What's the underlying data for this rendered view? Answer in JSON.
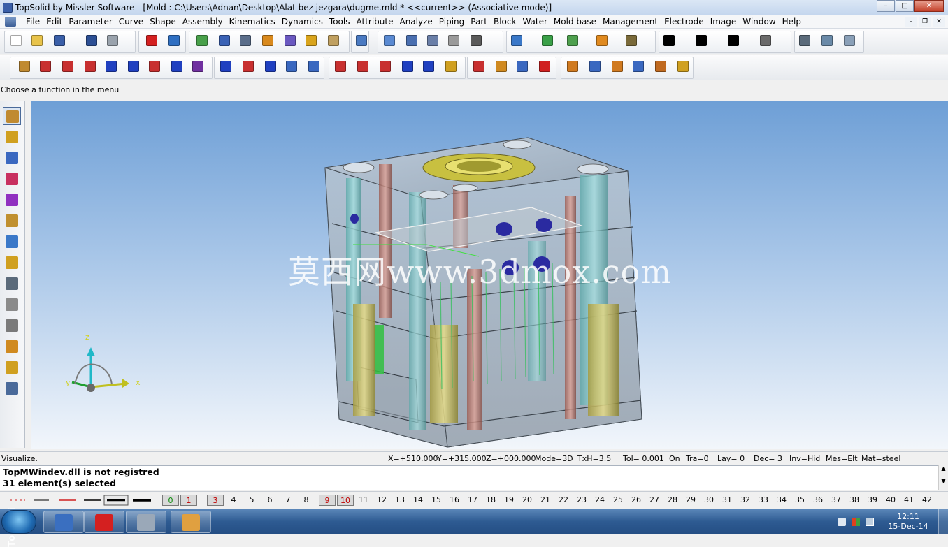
{
  "window": {
    "title": "TopSolid by Missler Software - [Mold : C:\\Users\\Adnan\\Desktop\\Alat bez jezgara\\dugme.mld *  <<current>> (Associative mode)]",
    "minimize": "–",
    "maximize": "□",
    "close": "✕"
  },
  "menu": [
    "File",
    "Edit",
    "Parameter",
    "Curve",
    "Shape",
    "Assembly",
    "Kinematics",
    "Dynamics",
    "Tools",
    "Attribute",
    "Analyze",
    "Piping",
    "Part",
    "Block",
    "Water",
    "Mold base",
    "Management",
    "Electrode",
    "Image",
    "Window",
    "Help"
  ],
  "mdi_buttons": [
    "–",
    "❐",
    "✕"
  ],
  "toolbar1": [
    {
      "name": "new-file-icon",
      "color": "#ffffff"
    },
    {
      "name": "open-folder-icon",
      "color": "#e8c34a"
    },
    {
      "name": "save-icon",
      "color": "#3a5fa8"
    },
    {
      "name": "info-icon",
      "color": "#2c4f94"
    },
    {
      "name": "print-icon",
      "color": "#9aa3ad"
    },
    {
      "name": "delete-icon",
      "color": "#d42020"
    },
    {
      "name": "undo-icon",
      "color": "#2f6fc2"
    },
    {
      "name": "refresh-icon",
      "color": "#48a04a"
    },
    {
      "name": "render-icon",
      "color": "#3a62b5"
    },
    {
      "name": "mixer-icon",
      "color": "#5a6d8a"
    },
    {
      "name": "hammer-icon",
      "color": "#d9891c"
    },
    {
      "name": "tools-icon",
      "color": "#6a58c0"
    },
    {
      "name": "magic-icon",
      "color": "#d9a41c"
    },
    {
      "name": "eye-icon",
      "color": "#c0a060"
    },
    {
      "name": "select-icon",
      "color": "#4a7ac2"
    },
    {
      "name": "pick-icon",
      "color": "#5a8ad2"
    },
    {
      "name": "trim-icon",
      "color": "#4a6fb0"
    },
    {
      "name": "gauge-icon",
      "color": "#6a7fa8"
    },
    {
      "name": "magnet-icon",
      "color": "#9a9a9a"
    },
    {
      "name": "sketch-icon",
      "color": "#5a5a5a"
    },
    {
      "name": "zoom-icon",
      "color": "#3a78c8"
    },
    {
      "name": "zoom-fit-icon",
      "color": "#3aa048"
    },
    {
      "name": "view-icon",
      "color": "#4ea04e"
    },
    {
      "name": "rotate-icon",
      "color": "#e08a20"
    },
    {
      "name": "pan-icon",
      "color": "#7a6a3a"
    },
    {
      "name": "color-black-icon",
      "color": "#000000"
    },
    {
      "name": "point-style-icon",
      "color": "#000000"
    },
    {
      "name": "line-style-icon",
      "color": "#000000"
    },
    {
      "name": "hatch-icon",
      "color": "#6a6a6a"
    },
    {
      "name": "camera-icon",
      "color": "#5a6a7a"
    },
    {
      "name": "layers-icon",
      "color": "#6a8aa8"
    },
    {
      "name": "box-view-icon",
      "color": "#8aa0b8"
    }
  ],
  "toolbar2": [
    {
      "name": "pencil-icon",
      "color": "#c08a30"
    },
    {
      "name": "polyline-icon",
      "color": "#c83030"
    },
    {
      "name": "line-icon",
      "color": "#c83030"
    },
    {
      "name": "circle-icon",
      "color": "#c83030"
    },
    {
      "name": "rectangle-icon",
      "color": "#2040c0"
    },
    {
      "name": "frame-icon",
      "color": "#2040c0"
    },
    {
      "name": "spline-icon",
      "color": "#c83030"
    },
    {
      "name": "ellipse-icon",
      "color": "#2040c0"
    },
    {
      "name": "polygon-icon",
      "color": "#7030a0"
    },
    {
      "name": "offset-icon",
      "color": "#2040c0"
    },
    {
      "name": "point-icon",
      "color": "#c83030"
    },
    {
      "name": "slot-icon",
      "color": "#2040c0"
    },
    {
      "name": "cube-icon",
      "color": "#3a68c0"
    },
    {
      "name": "profile-icon",
      "color": "#3a68c0"
    },
    {
      "name": "fillet-icon",
      "color": "#c83030"
    },
    {
      "name": "chamfer-icon",
      "color": "#c83030"
    },
    {
      "name": "copy-icon",
      "color": "#c83030"
    },
    {
      "name": "arc-icon",
      "color": "#2040c0"
    },
    {
      "name": "dimension-icon",
      "color": "#2040c0"
    },
    {
      "name": "text-icon",
      "color": "#d0a020"
    },
    {
      "name": "move-icon",
      "color": "#c83030"
    },
    {
      "name": "rotate-element-icon",
      "color": "#d08a20"
    },
    {
      "name": "stretch-icon",
      "color": "#3a68c0"
    },
    {
      "name": "erase-icon",
      "color": "#d02020"
    },
    {
      "name": "plate-icon",
      "color": "#d07a20"
    },
    {
      "name": "plate-add-icon",
      "color": "#3a68c0"
    },
    {
      "name": "plate-stack-icon",
      "color": "#d07a20"
    },
    {
      "name": "mold-part-icon",
      "color": "#3a68c0"
    },
    {
      "name": "tree-icon",
      "color": "#c06a20"
    },
    {
      "name": "list-icon",
      "color": "#d0a020"
    }
  ],
  "status_prompt": "Choose a function in the menu",
  "left_toolbar": [
    {
      "name": "sketch-mode-icon",
      "color": "#c08a30"
    },
    {
      "name": "curve-mode-icon",
      "color": "#d0a020"
    },
    {
      "name": "shape-mode-icon",
      "color": "#3a68c0"
    },
    {
      "name": "drafting-mode-icon",
      "color": "#c83060"
    },
    {
      "name": "assembly-mode-icon",
      "color": "#9030c0"
    },
    {
      "name": "mold-mode-icon",
      "color": "#c09030"
    },
    {
      "name": "tool-mode-icon",
      "color": "#3a78c8"
    },
    {
      "name": "ejector-mode-icon",
      "color": "#d0a020"
    },
    {
      "name": "plate-mode-icon",
      "color": "#5a6a7a"
    },
    {
      "name": "screw-mode-icon",
      "color": "#8a8a8a"
    },
    {
      "name": "pin-mode-icon",
      "color": "#7a7a7a"
    },
    {
      "name": "electrode-mode-icon",
      "color": "#d08a20"
    },
    {
      "name": "cooling-mode-icon",
      "color": "#d0a020"
    },
    {
      "name": "misc-mode-icon",
      "color": "#4a6a9a"
    }
  ],
  "vertical_label": "TopSolid",
  "watermark": "莫西网www.3dmox.com",
  "triad": {
    "z": "z",
    "y": "y",
    "x": "x"
  },
  "coords": {
    "mode_label": "Visualize.",
    "x": "X=+510.000",
    "y": "Y=+315.000",
    "z": "Z=+000.000",
    "mode": "Mode=3D",
    "txh": "TxH=3.5",
    "tol": "Tol= 0.001",
    "on": "On",
    "tra": "Tra=0",
    "lay": "Lay=  0",
    "dec": "Dec= 3",
    "inv": "Inv=Hid",
    "mes": "Mes=Elt",
    "mat": "Mat=steel"
  },
  "messages": [
    "TopMWindev.dll is not registred",
    "31 element(s) selected"
  ],
  "layers": [
    "0",
    "1",
    "3",
    "4",
    "5",
    "6",
    "7",
    "8",
    "9",
    "10",
    "11",
    "12",
    "13",
    "14",
    "15",
    "16",
    "17",
    "18",
    "19",
    "20",
    "21",
    "22",
    "23",
    "24",
    "25",
    "26",
    "27",
    "28",
    "29",
    "30",
    "31",
    "32",
    "33",
    "34",
    "35",
    "36",
    "37",
    "38",
    "39",
    "40",
    "41",
    "42"
  ],
  "taskbar": {
    "apps": [
      {
        "name": "topsolid-taskbar-icon",
        "color": "#3a6fc0"
      },
      {
        "name": "solidworks-taskbar-icon",
        "color": "#d42020"
      },
      {
        "name": "calculator-taskbar-icon",
        "color": "#9aa8b8"
      },
      {
        "name": "paint-taskbar-icon",
        "color": "#e0a040"
      }
    ],
    "time": "12:11",
    "date": "15-Dec-14"
  },
  "colors": {
    "accent": "#3a68c0",
    "viewport_top": "#6e9fd6",
    "viewport_bottom": "#f2f6fb"
  }
}
